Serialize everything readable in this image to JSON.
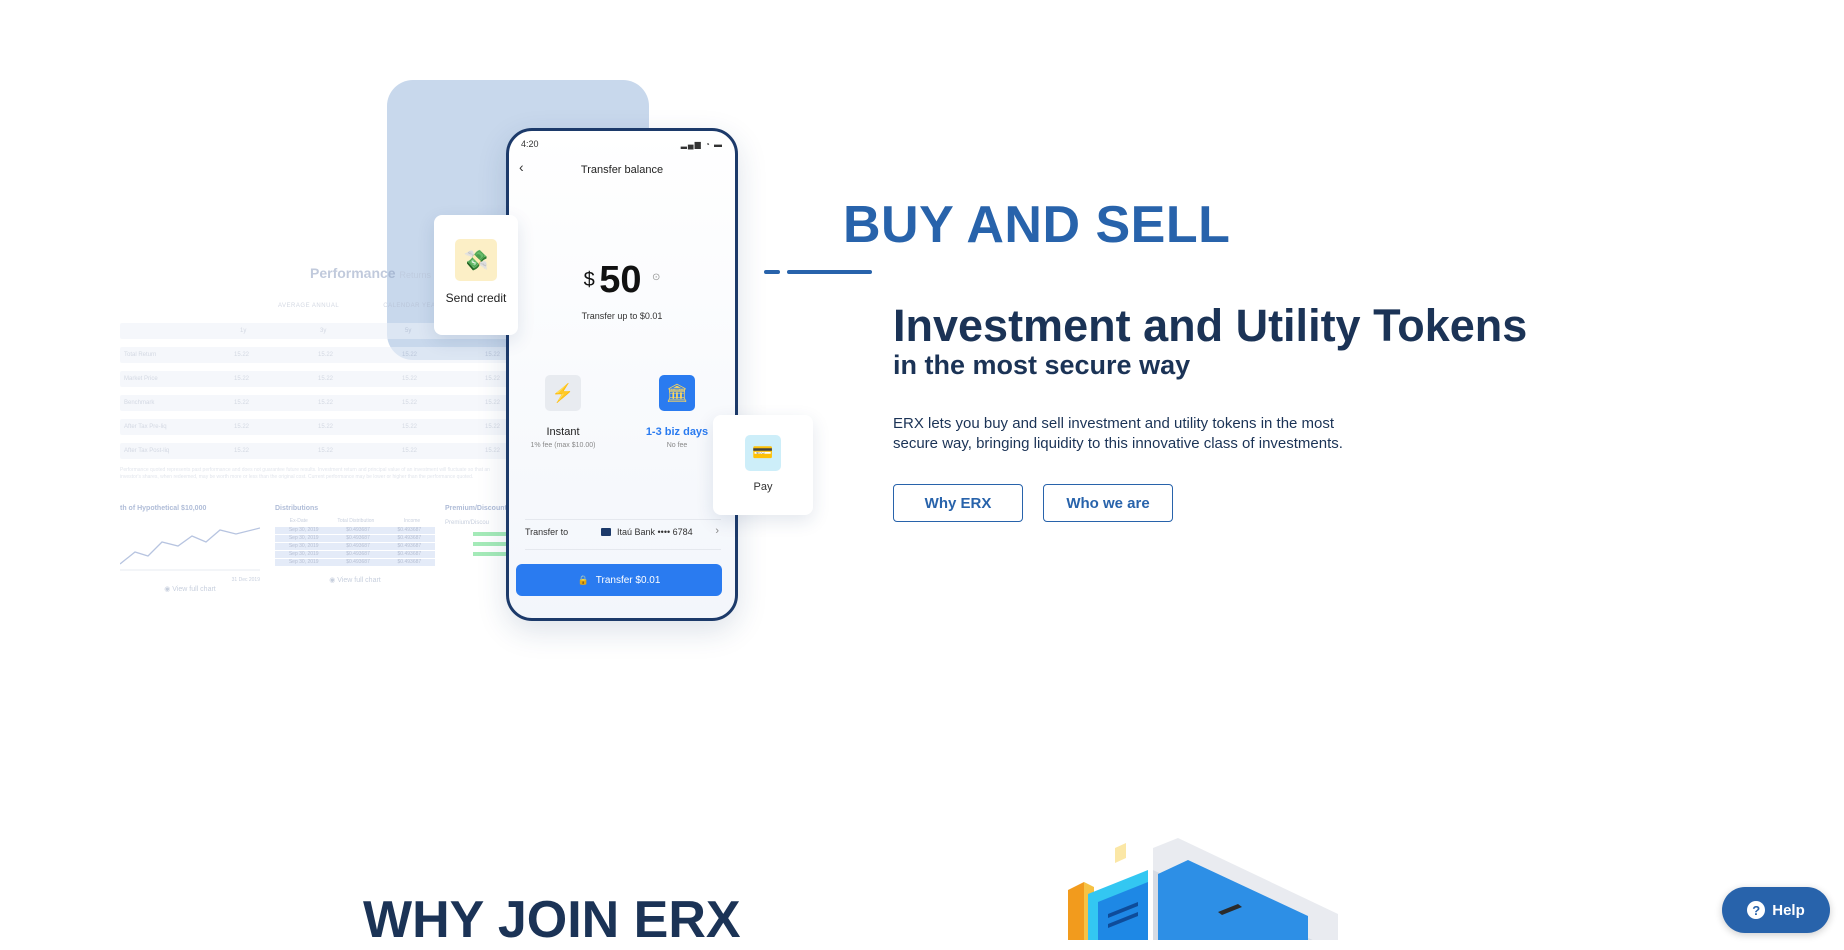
{
  "illustration": {
    "dashboard": {
      "title": "Performance",
      "title_suffix": "Returns",
      "tabs": [
        "AVERAGE ANNUAL",
        "CALENDAR YEAR"
      ],
      "header_cols": [
        "1y",
        "3y",
        "5y"
      ],
      "rows": [
        {
          "label": "Total Return",
          "v1": "15.22",
          "v2": "15.22",
          "v3": "15.22",
          "v4": "15.22"
        },
        {
          "label": "Market Price",
          "v1": "15.22",
          "v2": "15.22",
          "v3": "15.22",
          "v4": "15.22"
        },
        {
          "label": "Benchmark",
          "v1": "15.22",
          "v2": "15.22",
          "v3": "15.22",
          "v4": "15.22"
        },
        {
          "label": "After Tax Pre-liq",
          "v1": "15.22",
          "v2": "15.22",
          "v3": "15.22",
          "v4": "15.22"
        },
        {
          "label": "After Tax Post-liq",
          "v1": "15.22",
          "v2": "15.22",
          "v3": "15.22",
          "v4": "15.22"
        }
      ],
      "footnote": "Performance quoted represents past performance and does not guarantee future results. Investment return and principal value of an investment will fluctuate so that an investor's shares, when redeemed, may be worth more or less than the original cost. Current performance may be lower or higher than the performance quoted.",
      "growth_title": "th of Hypothetical $10,000",
      "growth_date": "31 Dec 2019",
      "distributions_title": "Distributions",
      "distributions_cols": [
        "Ex-Date",
        "Total Distribution",
        "Income"
      ],
      "distributions_rows": [
        [
          "Sep 30, 2019",
          "$0.493687",
          "$0.493687"
        ],
        [
          "Sep 30, 2019",
          "$0.493687",
          "$0.493687"
        ],
        [
          "Sep 30, 2019",
          "$0.493687",
          "$0.493687"
        ],
        [
          "Sep 30, 2019",
          "$0.493687",
          "$0.493687"
        ],
        [
          "Sep 30, 2019",
          "$0.493687",
          "$0.493687"
        ]
      ],
      "premium_title": "Premium/Discount",
      "premium_sub": "Premium/Discou",
      "view_full_chart": "View full chart"
    },
    "phone": {
      "time": "4:20",
      "status_icons": "▂▄▆ ◔ ▬",
      "back_icon": "‹",
      "title": "Transfer balance",
      "currency": "$",
      "amount": "50",
      "info_icon": "⊙",
      "limit_text": "Transfer up to $0.01",
      "options": [
        {
          "icon": "⚡",
          "label": "Instant",
          "sub": "1% fee (max $10.00)",
          "color": "#222222"
        },
        {
          "icon": "🏛",
          "label": "1-3 biz days",
          "sub": "No fee",
          "color": "#2a7bf0"
        }
      ],
      "transfer_to_label": "Transfer to",
      "bank_label": "Itaú Bank •••• 6784",
      "chevron": "›",
      "cta_icon": "🔒",
      "cta_label": "Transfer $0.01"
    },
    "send_card": {
      "icon": "💸",
      "label": "Send credit"
    },
    "pay_card": {
      "icon": "💳",
      "label": "Pay"
    }
  },
  "hero": {
    "eyebrow": "BUY AND SELL",
    "headline": "Investment and Utility Tokens",
    "subheadline": "in the most secure way",
    "description": "ERX lets you buy and sell investment and utility tokens in the most secure way, bringing liquidity to this innovative class of investments.",
    "buttons": {
      "why": "Why ERX",
      "who": "Who we are"
    }
  },
  "section_next": {
    "title": "WHY JOIN ERX"
  },
  "help_widget": {
    "icon": "?",
    "label": "Help"
  },
  "colors": {
    "accent": "#2863ab",
    "navy": "#1b3356",
    "phone_blue": "#2a7bf0"
  }
}
